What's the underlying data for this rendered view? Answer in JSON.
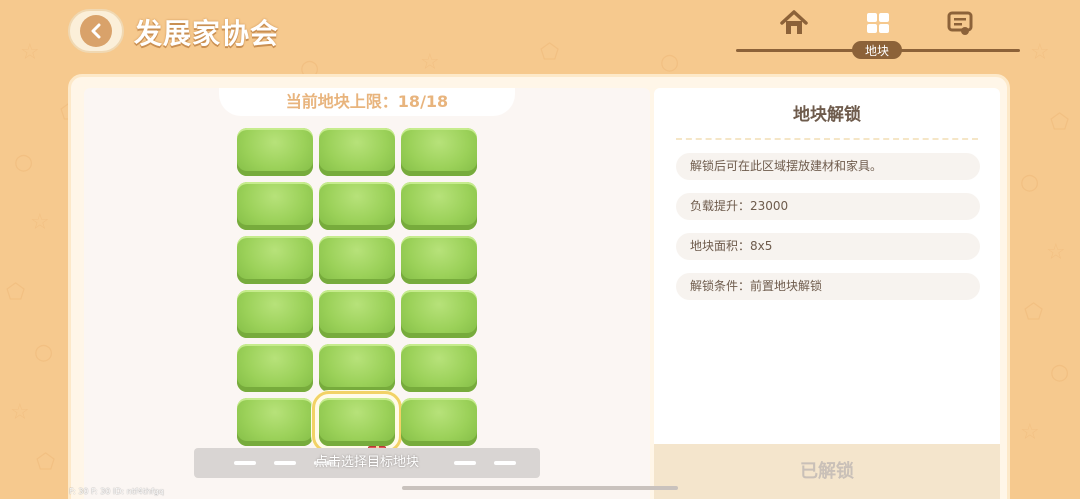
{
  "header": {
    "title": "发展家协会",
    "back_icon": "chevron-left-icon"
  },
  "top_tabs": {
    "items": [
      {
        "icon": "house-icon",
        "label": ""
      },
      {
        "icon": "plots-icon",
        "label": "地块",
        "active": true
      },
      {
        "icon": "certificate-icon",
        "label": ""
      }
    ],
    "active_label": "地块"
  },
  "plots": {
    "limit_text": "当前地块上限：18/18",
    "rows": 6,
    "cols": 3,
    "selected_row": 5,
    "selected_col": 1,
    "hint": "点击选择目标地块"
  },
  "info": {
    "title": "地块解锁",
    "rows": [
      "解锁后可在此区域摆放建材和家具。",
      "负载提升：23000",
      "地块面积：8x5",
      "解锁条件：前置地块解锁"
    ],
    "status_button": "已解锁"
  },
  "debug": "F: 30   F: 30   ID: ntf4thfgq",
  "colors": {
    "background": "#f6c98e",
    "grass": "#9bd159",
    "accent_brown": "#8c6239",
    "selected_outline": "#f2d266"
  }
}
